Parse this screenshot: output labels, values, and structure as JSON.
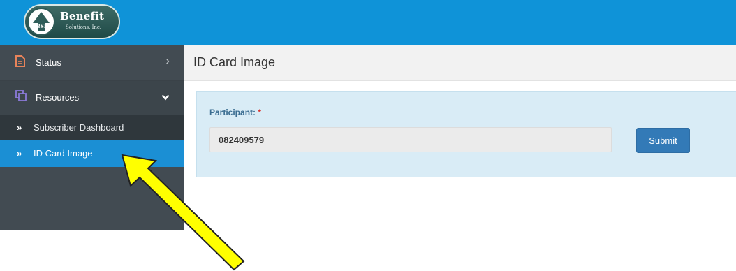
{
  "brand": {
    "name": "Benefit",
    "subtitle": "Solutions, Inc.",
    "emblem_text": "BSI",
    "colors": {
      "topbar": "#0f93d8",
      "sidebar": "#424b52",
      "active": "#1b8fd4"
    }
  },
  "sidebar": {
    "items": [
      {
        "label": "Status",
        "icon": "document-icon",
        "icon_color": "#e8835a",
        "chevron": "›"
      },
      {
        "label": "Resources",
        "icon": "copy-icon",
        "icon_color": "#8b7ad9",
        "chevron": "⌄"
      }
    ],
    "subitems": [
      {
        "label": "Subscriber Dashboard",
        "bullet": "»"
      },
      {
        "label": "ID Card Image",
        "bullet": "»",
        "active": true
      }
    ]
  },
  "page": {
    "title": "ID Card Image"
  },
  "form": {
    "participant_label": "Participant:",
    "required_mark": "*",
    "participant_value": "082409579",
    "submit_label": "Submit"
  },
  "annotation": {
    "arrow_color": "#ffff00",
    "arrow_icon": "arrow-pointer-icon"
  }
}
